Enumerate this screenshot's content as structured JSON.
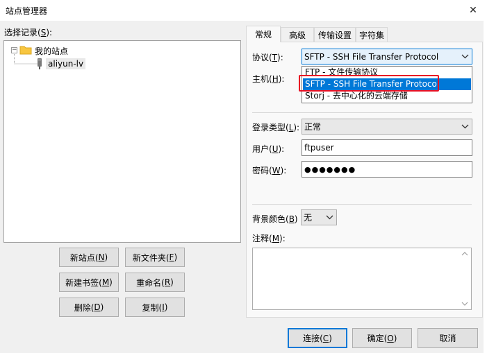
{
  "window": {
    "title": "站点管理器",
    "close_glyph": "✕"
  },
  "left": {
    "select_label_pre": "选择记录(",
    "select_label_key": "S",
    "select_label_post": "):",
    "tree": {
      "root": {
        "label": "我的站点",
        "expander": "−"
      },
      "child": {
        "label": "aliyun-lv"
      }
    },
    "buttons": [
      {
        "pre": "新站点(",
        "key": "N",
        "post": ")"
      },
      {
        "pre": "新文件夹(",
        "key": "F",
        "post": ")"
      },
      {
        "pre": "新建书签(",
        "key": "M",
        "post": ")"
      },
      {
        "pre": "重命名(",
        "key": "R",
        "post": ")"
      },
      {
        "pre": "删除(",
        "key": "D",
        "post": ")"
      },
      {
        "pre": "复制(",
        "key": "I",
        "post": ")"
      }
    ]
  },
  "tabs": [
    {
      "label": "常规",
      "active": true
    },
    {
      "label": "高级",
      "active": false
    },
    {
      "label": "传输设置",
      "active": false
    },
    {
      "label": "字符集",
      "active": false
    }
  ],
  "general": {
    "protocol": {
      "label_pre": "协议(",
      "label_key": "T",
      "label_post": "):",
      "value": "SFTP - SSH File Transfer Protocol",
      "options": [
        "FTP - 文件传输协议",
        "SFTP - SSH File Transfer Protocol",
        "Storj - 去中心化的云端存储"
      ],
      "highlighted_index": 1
    },
    "host": {
      "label_pre": "主机(",
      "label_key": "H",
      "label_post": "):"
    },
    "logon_type": {
      "label_pre": "登录类型(",
      "label_key": "L",
      "label_post": "):",
      "value": "正常"
    },
    "user": {
      "label_pre": "用户(",
      "label_key": "U",
      "label_post": "):",
      "value": "ftpuser"
    },
    "password": {
      "label_pre": "密码(",
      "label_key": "W",
      "label_post": "):",
      "value": "●●●●●●●"
    },
    "bg_color": {
      "label_pre": "背景颜色(",
      "label_key": "B",
      "label_post": ")",
      "value": "无"
    },
    "notes": {
      "label_pre": "注释(",
      "label_key": "M",
      "label_post": "):",
      "value": ""
    }
  },
  "footer": {
    "connect": {
      "pre": "连接(",
      "key": "C",
      "post": ")"
    },
    "ok": {
      "pre": "确定(",
      "key": "O",
      "post": ")"
    },
    "cancel": {
      "label": "取消"
    }
  },
  "colors": {
    "selection": "#0078d7",
    "highlight_box": "#e81123",
    "folder": "#f8c640"
  }
}
